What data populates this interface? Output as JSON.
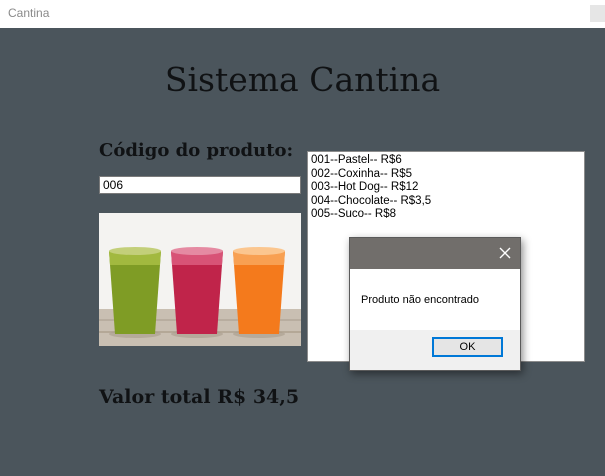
{
  "window": {
    "title": "Cantina"
  },
  "app": {
    "title": "Sistema Cantina",
    "code_label": "Código do produto:",
    "code_value": "006",
    "total_label": "Valor total R$ 34,5",
    "image_icon": "juice-cups-photo"
  },
  "products": [
    {
      "label": "001--Pastel-- R$6"
    },
    {
      "label": "002--Coxinha-- R$5"
    },
    {
      "label": "003--Hot Dog-- R$12"
    },
    {
      "label": "004--Chocolate-- R$3,5"
    },
    {
      "label": "005--Suco-- R$8"
    }
  ],
  "dialog": {
    "message": "Produto não encontrado",
    "ok_label": "OK",
    "close_icon": "close-icon"
  },
  "colors": {
    "background": "#4b555c",
    "dialog_header": "#716e6b",
    "focus_accent": "#0078d7",
    "juice_green": "#7f9c25",
    "juice_red": "#c0244a",
    "juice_orange": "#f47a1c"
  }
}
